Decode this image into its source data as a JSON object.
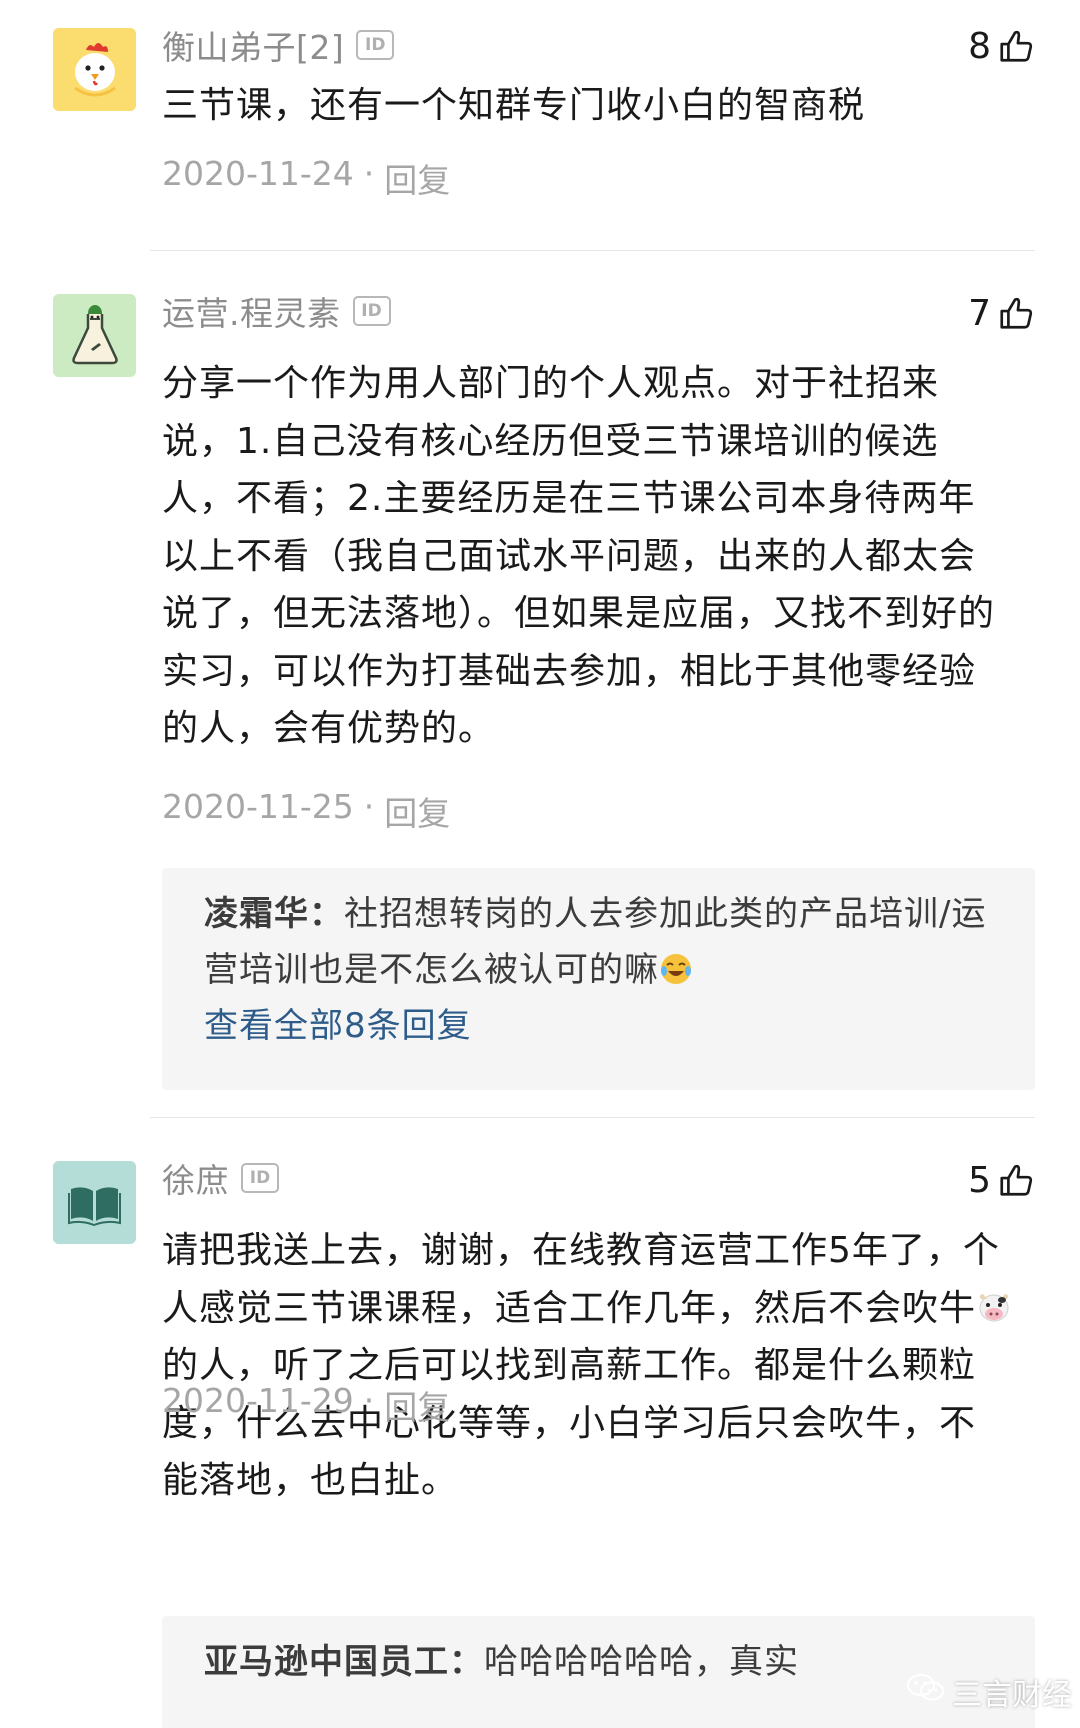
{
  "comments": [
    {
      "avatar_icon": "chicken-avatar",
      "name": "衡山弟子[2]",
      "id_badge": "ID",
      "likes": "8",
      "text": "三节课，还有一个知群专门收小白的智商税",
      "date": "2020-11-24",
      "dot": "·",
      "reply_label": "回复"
    },
    {
      "avatar_icon": "chemist-avatar",
      "name": "运营.程灵素",
      "id_badge": "ID",
      "likes": "7",
      "text": "分享一个作为用人部门的个人观点。对于社招来说，1.自己没有核心经历但受三节课培训的候选人，不看；2.主要经历是在三节课公司本身待两年以上不看（我自己面试水平问题，出来的人都太会说了，但无法落地）。但如果是应届，又找不到好的实习，可以作为打基础去参加，相比于其他零经验的人，会有优势的。",
      "date": "2020-11-25",
      "dot": "·",
      "reply_label": "回复",
      "reply": {
        "author": "凌霜华：",
        "text_before_emoji": "社招想转岗的人去参加此类的产品培训/运营培训也是不怎么被认可的嘛",
        "emoji": "tears-of-joy-emoji",
        "more": "查看全部8条回复"
      }
    },
    {
      "avatar_icon": "book-avatar",
      "name": "徐庶",
      "id_badge": "ID",
      "likes": "5",
      "text_part1": "请把我送上去，谢谢，在线教育运营工作5年了，个人感觉三节课课程，适合工作几年，然后不会吹牛",
      "emoji": "cow-face-emoji",
      "text_part2": "的人，听了之后可以找到高薪工作。都是什么颗粒度，什么去中心化等等，小白学习后只会吹牛，不能落地，也白扯。",
      "date": "2020-11-29",
      "dot": "·",
      "reply_label": "回复",
      "reply": {
        "author": "亚马逊中国员工：",
        "text": "哈哈哈哈哈哈，真实"
      }
    }
  ],
  "watermark": {
    "icon": "wechat-icon",
    "text": "三言财经"
  },
  "colors": {
    "name_gray": "#8c8c8c",
    "meta_gray": "#a6a6a6",
    "link_blue": "#2e5c8a",
    "reply_bg": "#f5f5f5"
  }
}
